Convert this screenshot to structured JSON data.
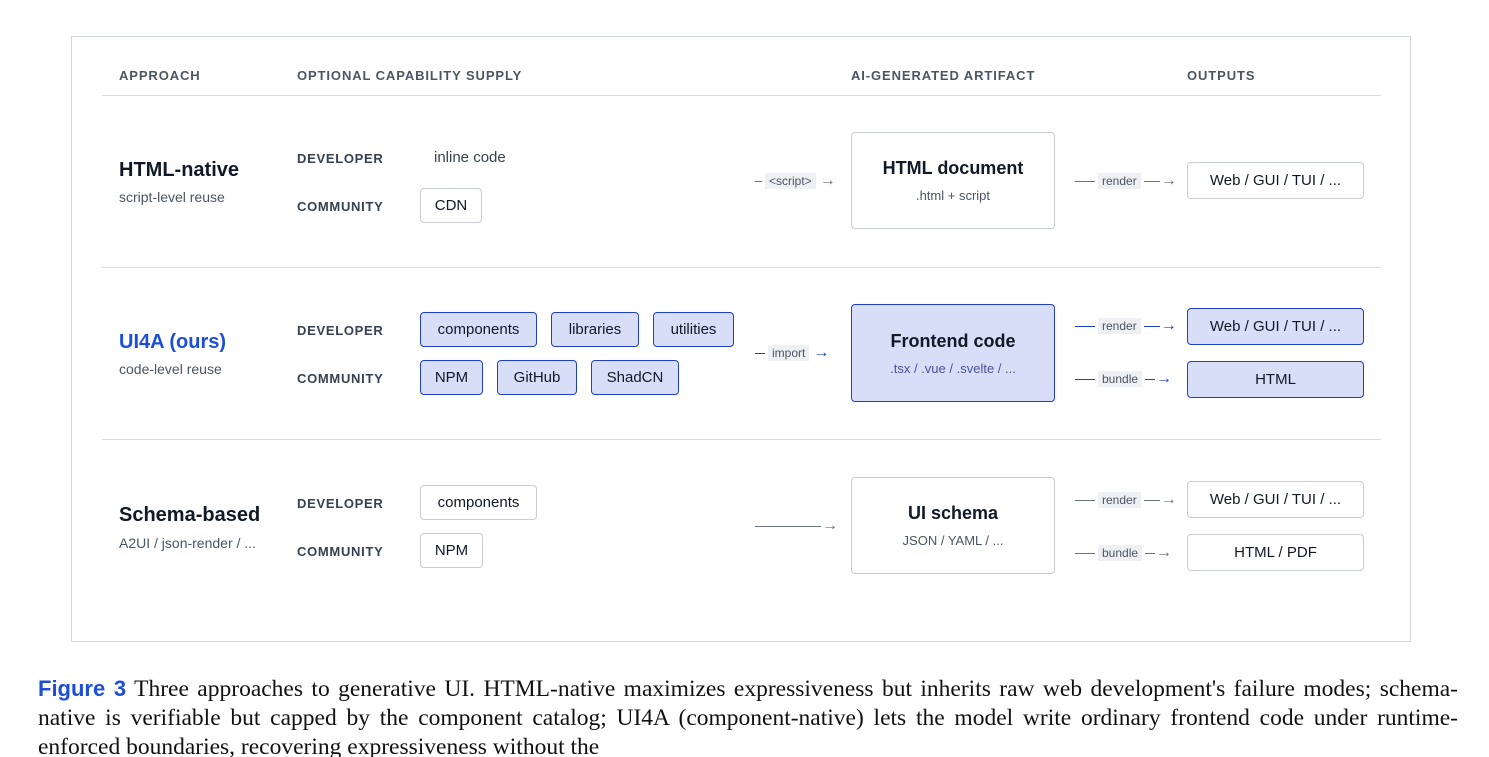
{
  "headers": {
    "approach": "APPROACH",
    "capability": "OPTIONAL CAPABILITY SUPPLY",
    "artifact": "AI-GENERATED ARTIFACT",
    "outputs": "OUTPUTS"
  },
  "rows": {
    "html_native": {
      "title": "HTML-native",
      "subtitle": "script-level reuse",
      "developer_label": "DEVELOPER",
      "developer_items": [
        "inline code"
      ],
      "community_label": "COMMUNITY",
      "community_items": [
        "CDN"
      ],
      "link_label": "<script>",
      "artifact_title": "HTML document",
      "artifact_sub": ".html + script",
      "out_links": [
        "render"
      ],
      "outputs": [
        "Web / GUI / TUI / ..."
      ]
    },
    "ui4a": {
      "title": "UI4A (ours)",
      "subtitle": "code-level reuse",
      "developer_label": "DEVELOPER",
      "developer_items": [
        "components",
        "libraries",
        "utilities"
      ],
      "community_label": "COMMUNITY",
      "community_items": [
        "NPM",
        "GitHub",
        "ShadCN"
      ],
      "link_label": "import",
      "artifact_title": "Frontend code",
      "artifact_sub": ".tsx / .vue / .svelte / ...",
      "out_links": [
        "render",
        "bundle"
      ],
      "outputs": [
        "Web / GUI / TUI / ...",
        "HTML"
      ]
    },
    "schema": {
      "title": "Schema-based",
      "subtitle": "A2UI / json-render / ...",
      "developer_label": "DEVELOPER",
      "developer_items": [
        "components"
      ],
      "community_label": "COMMUNITY",
      "community_items": [
        "NPM"
      ],
      "artifact_title": "UI schema",
      "artifact_sub": "JSON / YAML / ...",
      "out_links": [
        "render",
        "bundle"
      ],
      "outputs": [
        "Web / GUI / TUI / ...",
        "HTML / PDF"
      ]
    }
  },
  "caption": {
    "label": "Figure 3",
    "text": "Three approaches to generative UI. HTML-native maximizes expressiveness but inherits raw web development's failure modes; schema-native is verifiable but capped by the component catalog; UI4A (component-native) lets the model write ordinary frontend code under runtime-enforced boundaries, recovering expressiveness without the"
  },
  "colors": {
    "accent": "#1d4ed8",
    "highlight_fill": "#d8ddf8",
    "highlight_border": "#1f3fc9"
  }
}
